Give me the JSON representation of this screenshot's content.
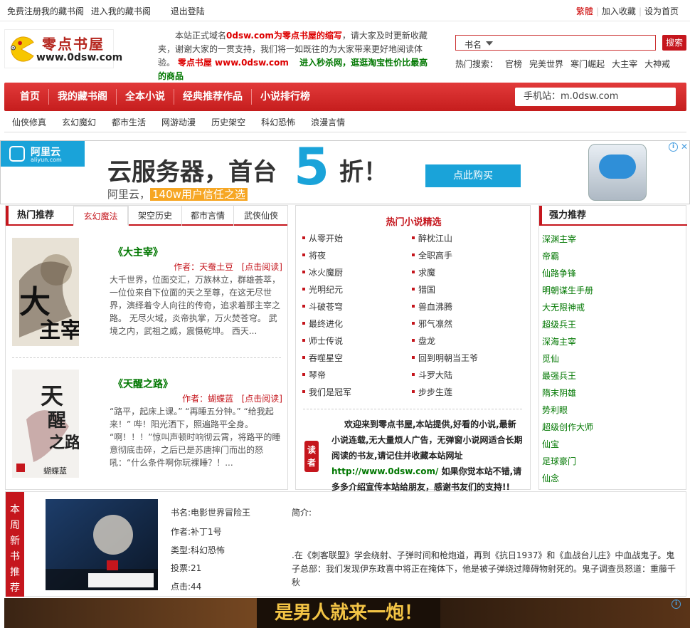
{
  "topbar": {
    "register": "免费注册我的藏书阁",
    "enter": "进入我的藏书阁",
    "logout": "退出登陆",
    "traditional": "繁體",
    "add_fav": "加入收藏",
    "set_home": "设为首页",
    "sep": "|"
  },
  "logo": {
    "title": "零点书屋",
    "url": "www.0dsw.com"
  },
  "notice": {
    "p1": "本站正式域名",
    "domain": "0dsw.com为零点书屋的缩写",
    "p2": "，请大家及时更新收藏夹，谢谢大家的一贯支持，我们将一如既往的为大家带来更好地阅读体验。",
    "site": "零点书屋 www.0dsw.com",
    "promo": "进入秒杀网，逛逛淘宝性价比最高的商品"
  },
  "search": {
    "type": "书名",
    "value": "",
    "button": "搜索"
  },
  "hot_search": {
    "label": "热门搜索：",
    "items": [
      "官榜",
      "完美世界",
      "寒门崛起",
      "大主宰",
      "大神戒"
    ]
  },
  "nav": {
    "items": [
      "首页",
      "我的藏书阁",
      "全本小说",
      "经典推荐作品",
      "小说排行榜"
    ],
    "mobile": "手机站：m.0dsw.com"
  },
  "subnav": [
    "仙侠修真",
    "玄幻魔幻",
    "都市生活",
    "网游动漫",
    "历史架空",
    "科幻恐怖",
    "浪漫言情"
  ],
  "ad1": {
    "brand": "阿里云",
    "brand_sub": "aliyun.com",
    "headline": "云服务器，首台",
    "num": "5",
    "zhe": "折！",
    "sub_a": "阿里云，",
    "sub_b": "140w用户信任之选",
    "button": "点此购买"
  },
  "left": {
    "title": "热门推荐",
    "tabs": [
      "玄幻魔法",
      "架空历史",
      "都市言情",
      "武侠仙侠"
    ],
    "books": [
      {
        "name": "《大主宰》",
        "author": "作者：天蚕土豆",
        "read": "[点击阅读]",
        "desc": "大千世界，位面交汇，万族林立，群雄荟萃，一位位来自下位面的天之至尊，在这无尽世界，演绎着令人向往的传奇，追求着那主宰之路。 无尽火域，炎帝执掌，万火焚苍穹。 武境之内，武祖之威，震慑乾坤。 西天..."
      },
      {
        "name": "《天醒之路》",
        "author": "作者：蝴蝶蓝",
        "read": "[点击阅读]",
        "desc": "“路平，起床上课。” “再睡五分钟。” “给我起来！” 哔！阳光洒下，照遍路平全身。 “啊！！！”惊叫声顿时响彻云霄，将路平的睡意彻底击碎，之后已是苏唐摔门而出的怒吼：“什么条件啊你玩裸睡？！..."
      }
    ]
  },
  "middle": {
    "title": "热门小说精选",
    "col1": [
      "从零开始",
      "将夜",
      "冰火魔厨",
      "光明纪元",
      "斗破苍穹",
      "最终进化",
      "师士传说",
      "吞噬星空",
      "琴帝",
      "我们是冠军"
    ],
    "col2": [
      "醉枕江山",
      "全职高手",
      "求魔",
      "猎国",
      "兽血沸腾",
      "邪气凛然",
      "盘龙",
      "回到明朝当王爷",
      "斗罗大陆",
      "步步生莲"
    ],
    "reader": "读者",
    "welcome_a": "欢迎来到零点书屋,本站提供,好看的小说,最新小说连载,无大量烦人广告，无弹窗小说网适合长期阅读的书友,请记住并收藏本站网址",
    "welcome_url": "http://www.0dsw.com/",
    "welcome_b": "如果你觉本站不错,请多多介绍宣传本站给朋友，感谢书友们的支持!!"
  },
  "right": {
    "title": "强力推荐",
    "items": [
      "深渊主宰",
      "帝霸",
      "仙路争锋",
      "明朝谋生手册",
      "大无限神戒",
      "超级兵王",
      "深海主宰",
      "觅仙",
      "最强兵王",
      "隋末阴雄",
      "势利眼",
      "超级创作大师",
      "仙宝",
      "足球豪门",
      "仙念"
    ]
  },
  "weekly": {
    "label": [
      "本",
      "周",
      "新",
      "书",
      "推",
      "荐"
    ],
    "name": "书名:电影世界冒险王",
    "author": "作者:补丁1号",
    "type": "类型:科幻恐怖",
    "votes": "投票:21",
    "clicks": "点击:44",
    "intro": "简介:",
    "synopsis": ".在《刺客联盟》学会绕射、子弹时间和枪炮道，再到《抗日1937》和《血战台儿庄》中血战鬼子。鬼子总部：我们发现伊东政喜中将正在掩体下，他是被子弹绕过障碍物射死的。鬼子调查员怒道：重藤千秋",
    "cover_text": "电影世界冒险王"
  },
  "ad2": {
    "text": "是男人就来一炮！"
  },
  "colors": {
    "red": "#c5161d",
    "green": "#007700",
    "blue": "#1aa3d9"
  }
}
